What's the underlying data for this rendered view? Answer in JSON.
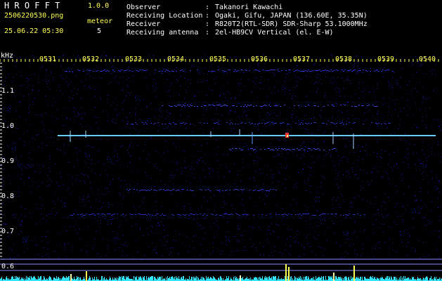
{
  "app": {
    "title": "HROFFT",
    "version": "1.0.0"
  },
  "file": {
    "name": "2506220530.png",
    "datetime": "25.06.22 05:30"
  },
  "meteor": {
    "label": "meteor",
    "count": "5"
  },
  "info": [
    {
      "label": "Observer",
      "value": "Takanori Kawachi"
    },
    {
      "label": "Receiving Location",
      "value": "Ogaki, Gifu, JAPAN (136.60E, 35.35N)"
    },
    {
      "label": "Receiver",
      "value": "R820T2(RTL-SDR) SDR-Sharp 53.1000MHz"
    },
    {
      "label": "Receiving antenna",
      "value": "2el-HB9CV Vertical (el. E-W)"
    }
  ],
  "axis": {
    "y_unit": "kHz",
    "y_ticks": [
      "1.1",
      "1.0",
      "0.9",
      "0.8",
      "0.7",
      "0.6"
    ],
    "x_ticks": [
      "0531",
      "0532",
      "0533",
      "0534",
      "0535",
      "0536",
      "0537",
      "0538",
      "0539",
      "0540"
    ]
  },
  "colors": {
    "title": "#ffffff",
    "accent": "#ffff55",
    "signal": "#66ddff",
    "noise": "#1a1ad0",
    "background": "#000000"
  }
}
